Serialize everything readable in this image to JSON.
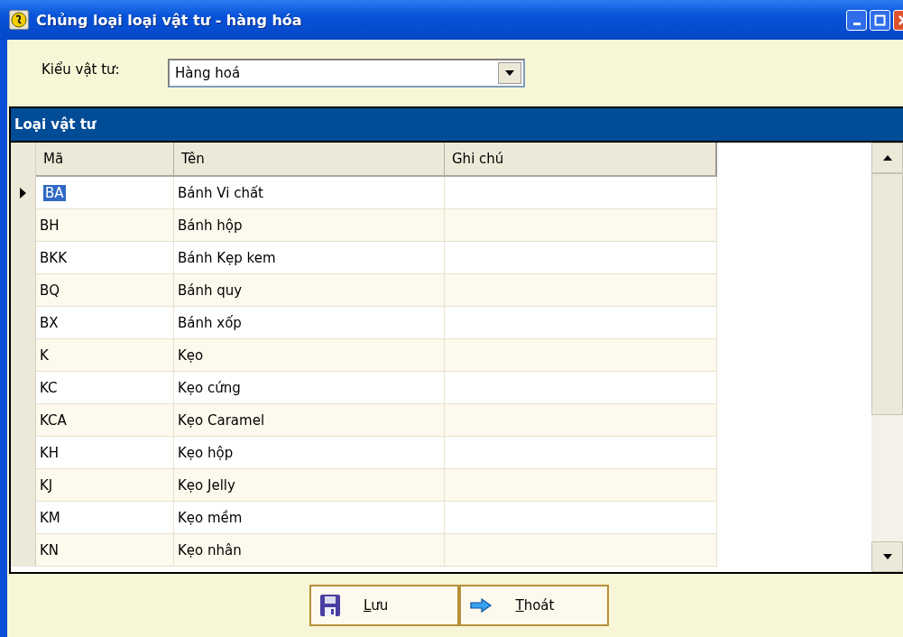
{
  "window": {
    "title": "Chủng loại loại vật tư - hàng hóa"
  },
  "filter": {
    "label": "Kiểu vật tư:",
    "value": "Hàng hoá"
  },
  "grid": {
    "caption": "Loại vật tư",
    "columns": [
      "Mã",
      "Tên",
      "Ghi chú"
    ],
    "rows": [
      {
        "code": "BA",
        "name": "Bánh Vi chất",
        "note": "",
        "selected": true
      },
      {
        "code": "BH",
        "name": "Bánh hộp",
        "note": "",
        "selected": false
      },
      {
        "code": "BKK",
        "name": "Bánh Kẹp kem",
        "note": "",
        "selected": false
      },
      {
        "code": "BQ",
        "name": "Bánh quy",
        "note": "",
        "selected": false
      },
      {
        "code": "BX",
        "name": "Bánh xốp",
        "note": "",
        "selected": false
      },
      {
        "code": "K",
        "name": "Kẹo",
        "note": "",
        "selected": false
      },
      {
        "code": "KC",
        "name": "Kẹo cứng",
        "note": "",
        "selected": false
      },
      {
        "code": "KCA",
        "name": "Kẹo Caramel",
        "note": "",
        "selected": false
      },
      {
        "code": "KH",
        "name": "Kẹo hộp",
        "note": "",
        "selected": false
      },
      {
        "code": "KJ",
        "name": "Kẹo Jelly",
        "note": "",
        "selected": false
      },
      {
        "code": "KM",
        "name": "Kẹo mềm",
        "note": "",
        "selected": false
      },
      {
        "code": "KN",
        "name": "Kẹo nhân",
        "note": "",
        "selected": false
      }
    ]
  },
  "buttons": [
    {
      "kind": "save",
      "label": "Lưu"
    },
    {
      "kind": "exit",
      "label": "Thoát"
    }
  ]
}
